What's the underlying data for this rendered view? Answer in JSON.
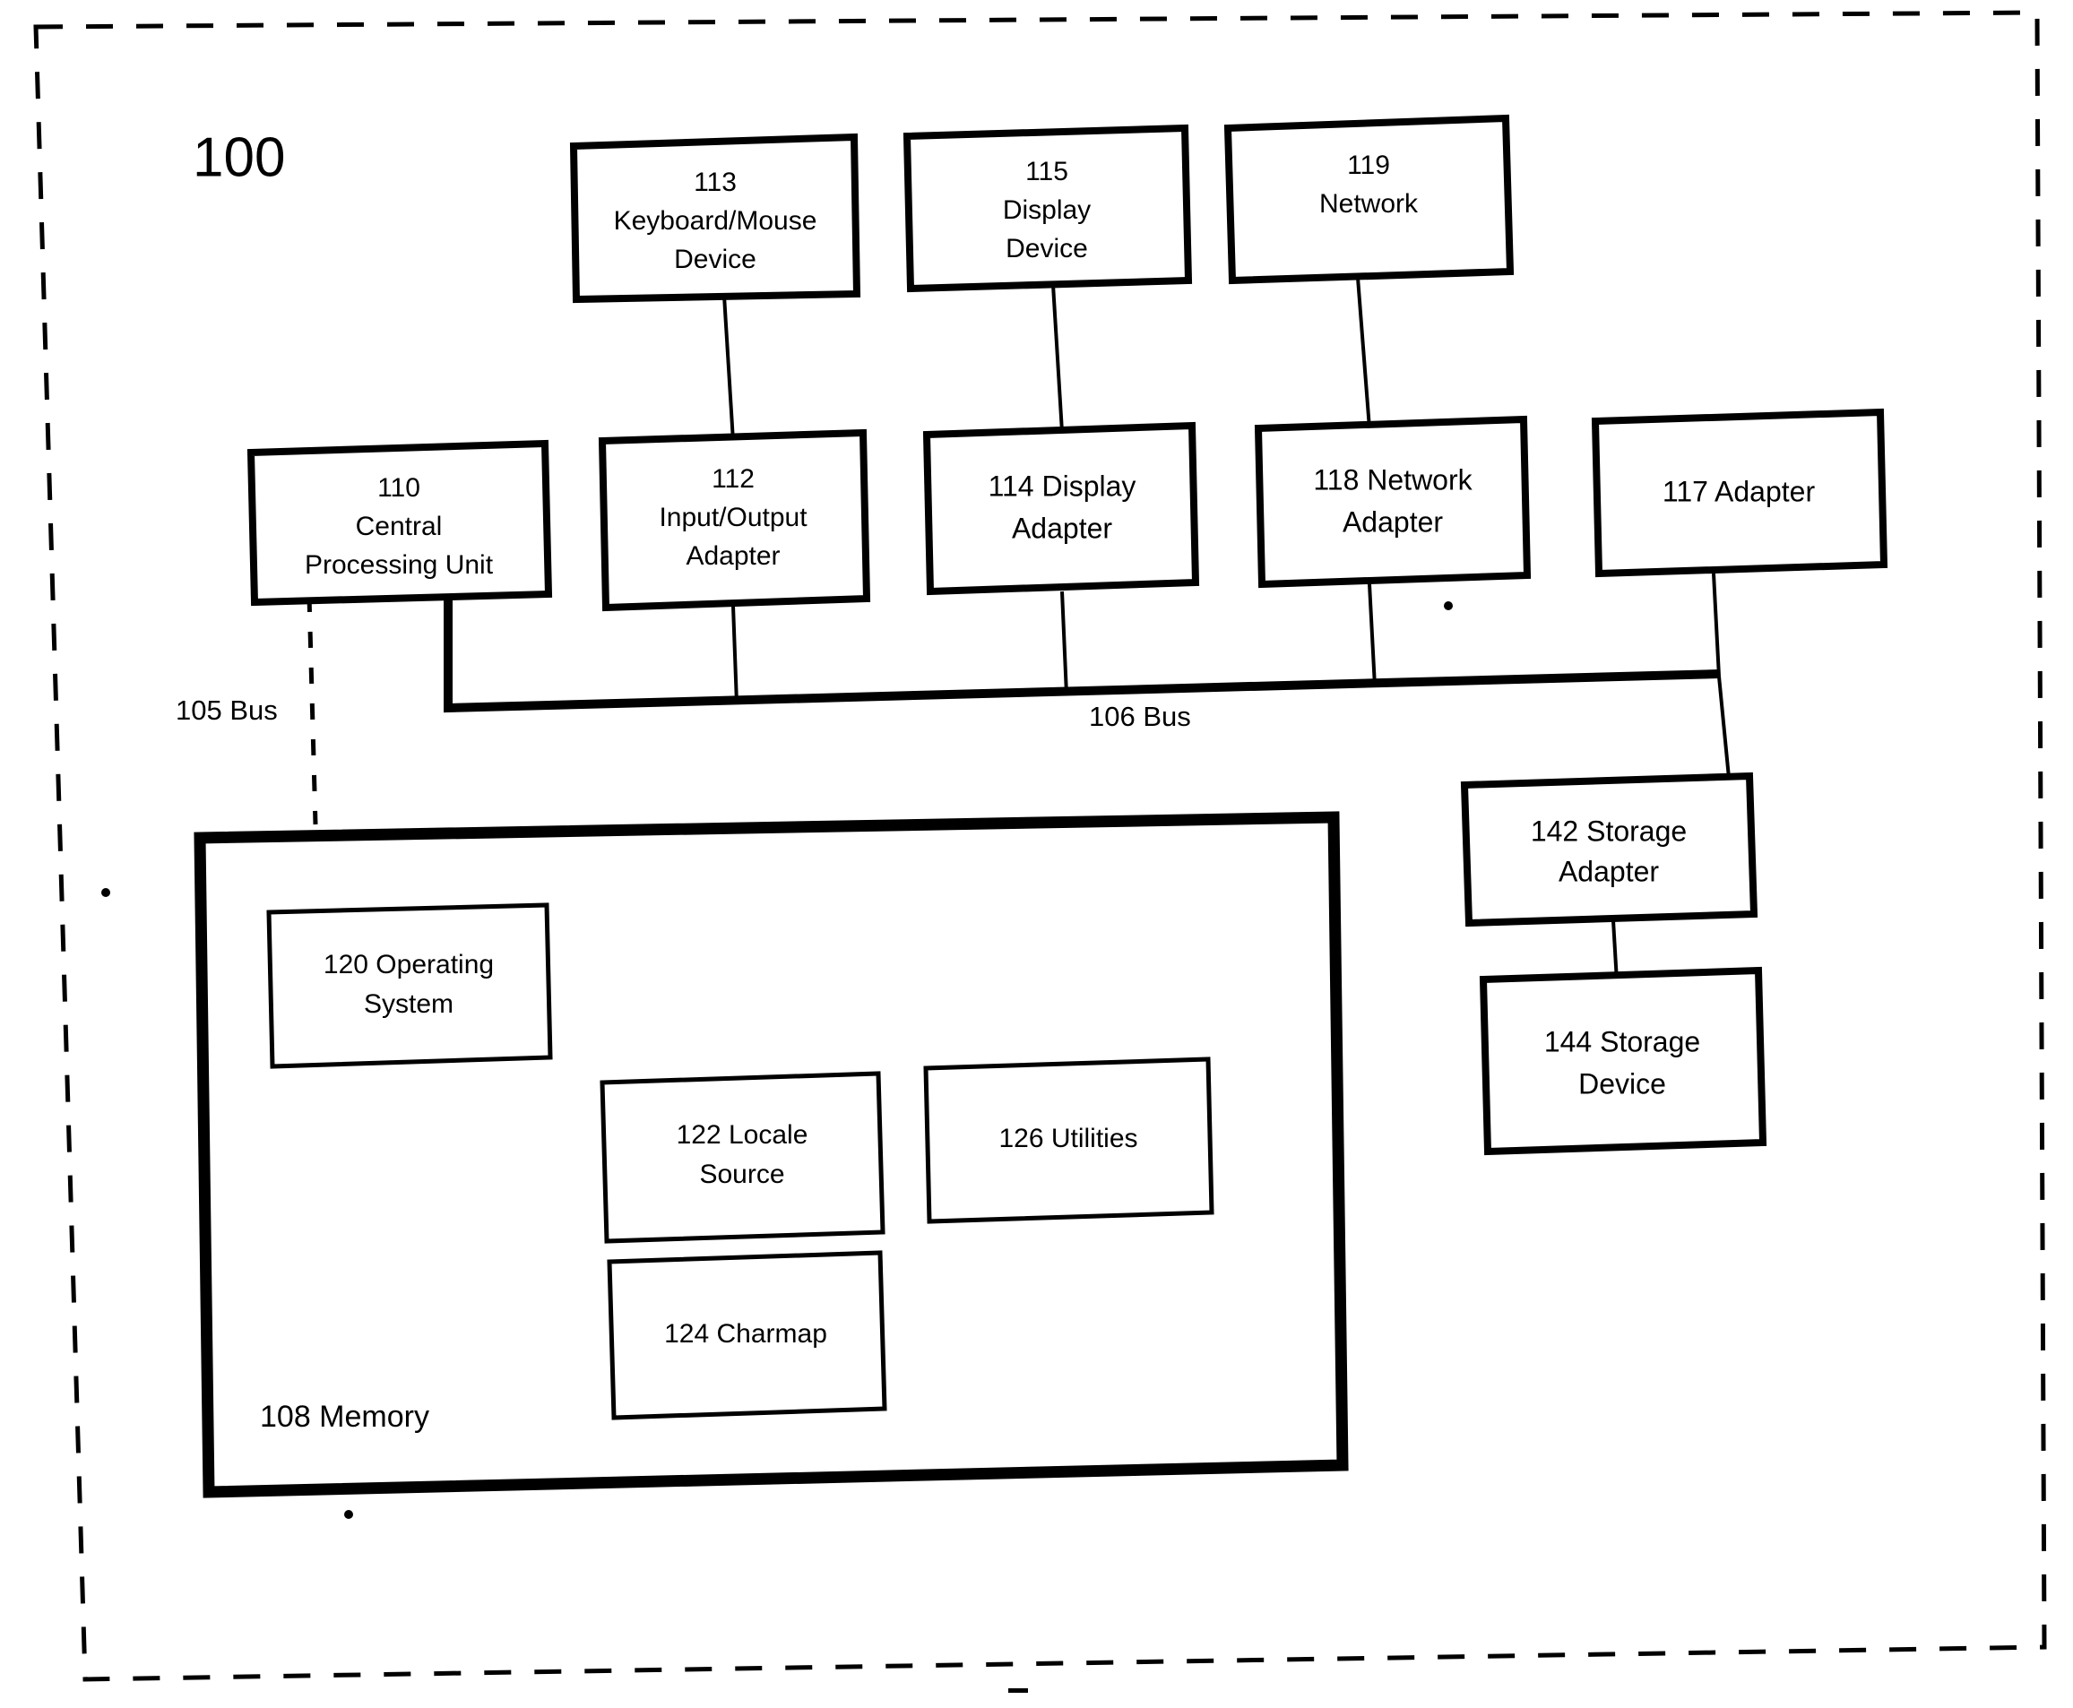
{
  "figure": {
    "number": "100",
    "type": "block-diagram",
    "outer_border": "dashed"
  },
  "colors": {
    "line": "#000000",
    "background": "#ffffff"
  },
  "boxes": {
    "keyboard_mouse": {
      "id": "113",
      "line1": "113",
      "line2": "Keyboard/Mouse",
      "line3": "Device"
    },
    "display_device": {
      "id": "115",
      "line1": "115",
      "line2": "Display",
      "line3": "Device"
    },
    "network": {
      "id": "119",
      "line1": "119",
      "line2": "Network",
      "line3": ""
    },
    "cpu": {
      "id": "110",
      "line1": "110",
      "line2": "Central",
      "line3": "Processing Unit"
    },
    "io_adapter": {
      "id": "112",
      "line1": "112",
      "line2": "Input/Output",
      "line3": "Adapter"
    },
    "display_adapter": {
      "id": "114",
      "line1": "114 Display",
      "line2": "Adapter",
      "line3": ""
    },
    "network_adapter": {
      "id": "118",
      "line1": "118 Network",
      "line2": "Adapter",
      "line3": ""
    },
    "adapter_117": {
      "id": "117",
      "line1": "117 Adapter",
      "line2": "",
      "line3": ""
    },
    "storage_adapter": {
      "id": "142",
      "line1": "142 Storage",
      "line2": "Adapter",
      "line3": ""
    },
    "storage_device": {
      "id": "144",
      "line1": "144 Storage",
      "line2": "Device",
      "line3": ""
    },
    "memory": {
      "id": "108",
      "label": "108 Memory"
    },
    "operating_system": {
      "id": "120",
      "line1": "120 Operating",
      "line2": "System",
      "line3": ""
    },
    "locale_source": {
      "id": "122",
      "line1": "122 Locale",
      "line2": "Source",
      "line3": ""
    },
    "charmap": {
      "id": "124",
      "line1": "124 Charmap",
      "line2": "",
      "line3": ""
    },
    "utilities": {
      "id": "126",
      "line1": "126 Utilities",
      "line2": "",
      "line3": ""
    }
  },
  "buses": {
    "bus_105": {
      "label": "105 Bus",
      "style": "dashed"
    },
    "bus_106": {
      "label": "106 Bus",
      "style": "solid-thick"
    }
  }
}
